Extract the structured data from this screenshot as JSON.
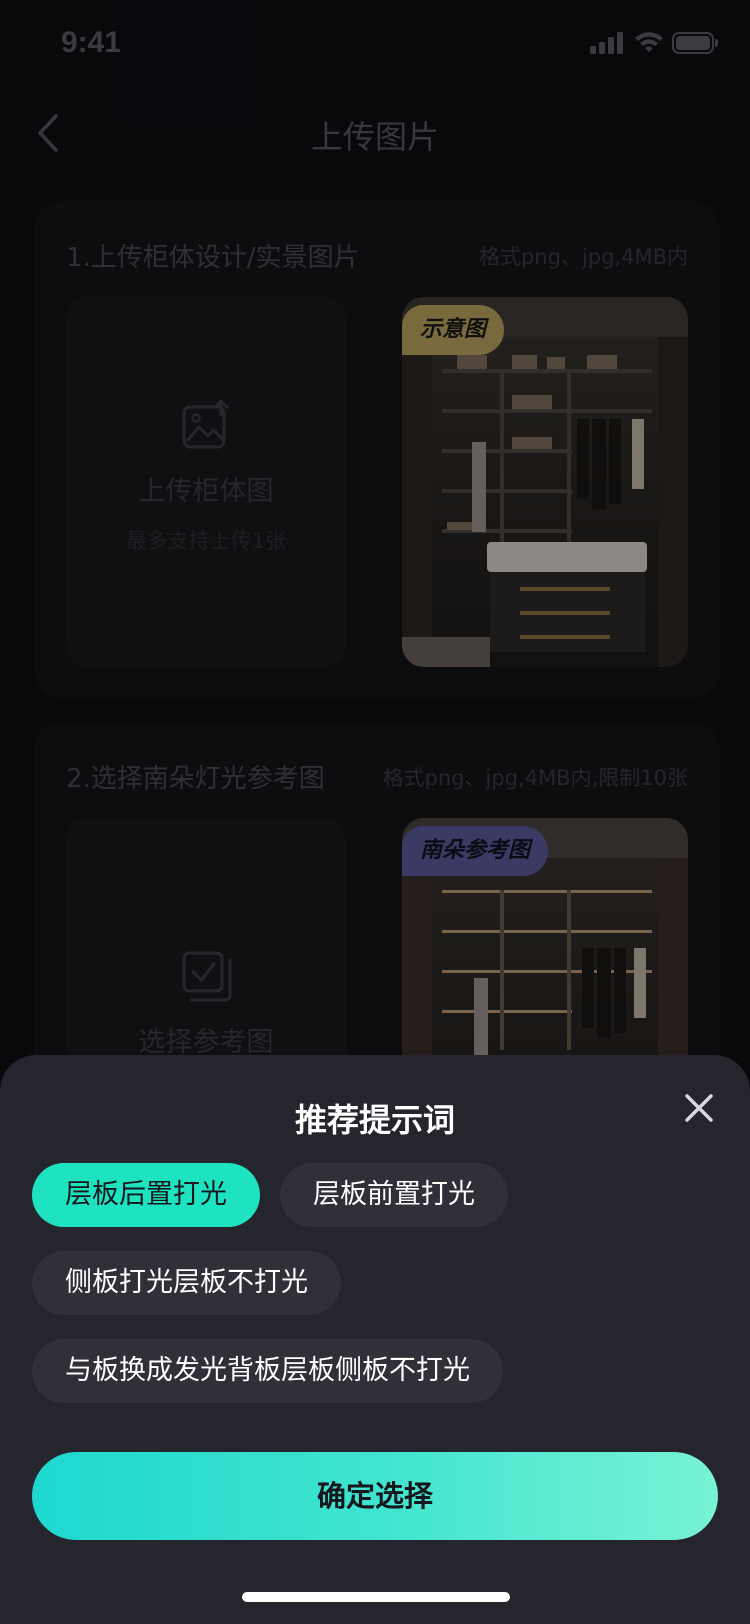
{
  "status_bar": {
    "time": "9:41"
  },
  "nav": {
    "title": "上传图片"
  },
  "section1": {
    "title": "1.上传柜体设计/实景图片",
    "format_hint": "格式png、jpg,4MB内",
    "upload_label": "上传柜体图",
    "upload_hint": "最多支持上传1张",
    "sample_badge": "示意图"
  },
  "section2": {
    "title": "2.选择南朵灯光参考图",
    "format_hint": "格式png、jpg,4MB内,限制10张",
    "upload_label": "选择参考图",
    "sample_badge": "南朵参考图"
  },
  "sheet": {
    "title": "推荐提示词",
    "chips": [
      {
        "label": "层板后置打光",
        "selected": true
      },
      {
        "label": "层板前置打光",
        "selected": false
      },
      {
        "label": "侧板打光层板不打光",
        "selected": false
      },
      {
        "label": "与板换成发光背板层板侧板不打光",
        "selected": false
      }
    ],
    "confirm_label": "确定选择"
  },
  "colors": {
    "accent": "#1ee3c1",
    "sheet_bg": "#24252d",
    "page_bg": "#0d0e12"
  }
}
